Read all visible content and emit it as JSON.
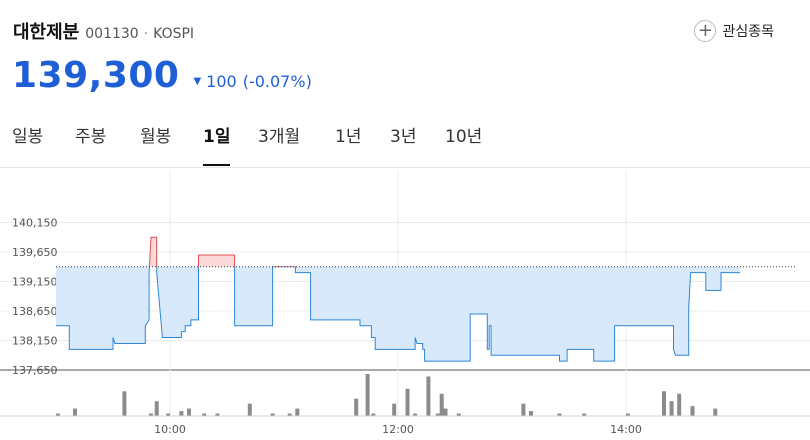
{
  "header": {
    "stock_name": "대한제분",
    "code": "001130",
    "separator": "·",
    "market": "KOSPI",
    "watch_label": "관심종목",
    "watch_icon": "plus-icon"
  },
  "price": {
    "current": "139,300",
    "change_icon": "triangle-down-icon",
    "change": "100",
    "change_pct": "(-0.07%)",
    "color": "#1f5fd6"
  },
  "tabs": [
    {
      "label": "일봉",
      "active": false
    },
    {
      "label": "주봉",
      "active": false
    },
    {
      "label": "월봉",
      "active": false
    },
    {
      "label": "1일",
      "active": true
    },
    {
      "label": "3개월",
      "active": false
    },
    {
      "label": "1년",
      "active": false
    },
    {
      "label": "3년",
      "active": false
    },
    {
      "label": "10년",
      "active": false
    }
  ],
  "chart_data": {
    "type": "line",
    "reference_price": 139400,
    "ylim": [
      137650,
      140650
    ],
    "y_ticks": [
      "140,150",
      "139,650",
      "139,150",
      "138,650",
      "138,150",
      "137,650"
    ],
    "y_tick_values": [
      140150,
      139650,
      139150,
      138650,
      138150,
      137650
    ],
    "x_ticks": [
      "10:00",
      "12:00",
      "14:00"
    ],
    "x_tick_values": [
      600,
      720,
      840
    ],
    "xlim": [
      540,
      930
    ],
    "colors": {
      "up": "#e05050",
      "up_fill": "#fcd9d9",
      "down": "#2f86d8",
      "down_fill": "#d8e9fb",
      "volume": "#8c8c8c"
    },
    "price_series": [
      [
        540,
        138400
      ],
      [
        547,
        138400
      ],
      [
        547,
        138000
      ],
      [
        570,
        138000
      ],
      [
        570,
        138200
      ],
      [
        571,
        138100
      ],
      [
        587,
        138100
      ],
      [
        587,
        138400
      ],
      [
        589,
        138500
      ],
      [
        589,
        139300
      ],
      [
        590,
        139900
      ],
      [
        593,
        139900
      ],
      [
        593,
        139300
      ],
      [
        596,
        138200
      ],
      [
        606,
        138200
      ],
      [
        606,
        138300
      ],
      [
        608,
        138300
      ],
      [
        608,
        138400
      ],
      [
        611,
        138400
      ],
      [
        611,
        138500
      ],
      [
        615,
        138500
      ],
      [
        615,
        139400
      ],
      [
        615,
        139600
      ],
      [
        634,
        139600
      ],
      [
        634,
        138400
      ],
      [
        654,
        138400
      ],
      [
        654,
        139400
      ],
      [
        666,
        139400
      ],
      [
        666,
        139300
      ],
      [
        674,
        139300
      ],
      [
        674,
        138500
      ],
      [
        700,
        138500
      ],
      [
        700,
        138400
      ],
      [
        706,
        138400
      ],
      [
        706,
        138200
      ],
      [
        708,
        138200
      ],
      [
        708,
        138000
      ],
      [
        729,
        138000
      ],
      [
        729,
        138200
      ],
      [
        730,
        138100
      ],
      [
        733,
        138100
      ],
      [
        733,
        138000
      ],
      [
        734,
        138000
      ],
      [
        734,
        137800
      ],
      [
        758,
        137800
      ],
      [
        758,
        138600
      ],
      [
        767,
        138600
      ],
      [
        767,
        138000
      ],
      [
        768,
        138000
      ],
      [
        768,
        138400
      ],
      [
        769,
        138400
      ],
      [
        769,
        137900
      ],
      [
        805,
        137900
      ],
      [
        805,
        137800
      ],
      [
        809,
        137800
      ],
      [
        809,
        138000
      ],
      [
        823,
        138000
      ],
      [
        823,
        137800
      ],
      [
        834,
        137800
      ],
      [
        834,
        138400
      ],
      [
        865,
        138400
      ],
      [
        865,
        138000
      ],
      [
        866,
        137900
      ],
      [
        873,
        137900
      ],
      [
        873,
        138700
      ],
      [
        874,
        139300
      ],
      [
        882,
        139300
      ],
      [
        882,
        139000
      ],
      [
        890,
        139000
      ],
      [
        890,
        139300
      ],
      [
        900,
        139300
      ]
    ],
    "volume_bars": [
      [
        541,
        1
      ],
      [
        550,
        3
      ],
      [
        576,
        10
      ],
      [
        590,
        1
      ],
      [
        593,
        6
      ],
      [
        599,
        1
      ],
      [
        606,
        2
      ],
      [
        610,
        3
      ],
      [
        618,
        1
      ],
      [
        625,
        1
      ],
      [
        642,
        5
      ],
      [
        654,
        1
      ],
      [
        663,
        1
      ],
      [
        667,
        3
      ],
      [
        698,
        7
      ],
      [
        704,
        17
      ],
      [
        707,
        1
      ],
      [
        718,
        5
      ],
      [
        725,
        11
      ],
      [
        729,
        1
      ],
      [
        736,
        16
      ],
      [
        741,
        1
      ],
      [
        743,
        9
      ],
      [
        745,
        3
      ],
      [
        752,
        1
      ],
      [
        786,
        5
      ],
      [
        790,
        2
      ],
      [
        805,
        1
      ],
      [
        818,
        1
      ],
      [
        841,
        1
      ],
      [
        860,
        10
      ],
      [
        864,
        6
      ],
      [
        868,
        9
      ],
      [
        875,
        4
      ],
      [
        887,
        3
      ]
    ],
    "volume_max": 17
  }
}
